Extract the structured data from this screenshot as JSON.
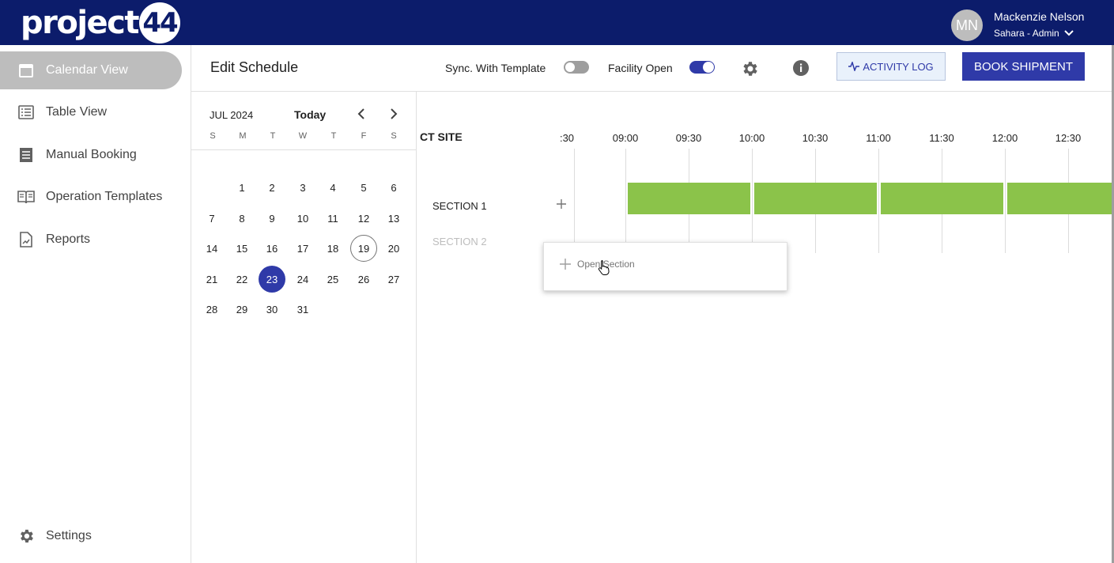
{
  "app": {
    "logo_text": "project",
    "logo_number": "44"
  },
  "user": {
    "initials": "MN",
    "name": "Mackenzie Nelson",
    "org_role": "Sahara - Admin"
  },
  "sidebar": {
    "items": [
      {
        "label": "Calendar View",
        "icon": "calendar-icon",
        "active": true
      },
      {
        "label": "Table View",
        "icon": "list-icon",
        "active": false
      },
      {
        "label": "Manual Booking",
        "icon": "receipt-icon",
        "active": false
      },
      {
        "label": "Operation Templates",
        "icon": "book-icon",
        "active": false
      },
      {
        "label": "Reports",
        "icon": "report-icon",
        "active": false
      }
    ],
    "settings_label": "Settings"
  },
  "header": {
    "title": "Edit Schedule",
    "sync_label": "Sync. With Template",
    "sync_on": false,
    "facility_label": "Facility Open",
    "facility_on": true,
    "activity_log_label": "ACTIVITY LOG",
    "book_label": "BOOK SHIPMENT"
  },
  "calendar": {
    "month": "JUL 2024",
    "today_label": "Today",
    "weekdays": [
      "S",
      "M",
      "T",
      "W",
      "T",
      "F",
      "S"
    ],
    "weeks": [
      [
        "",
        "1",
        "2",
        "3",
        "4",
        "5",
        "6"
      ],
      [
        "7",
        "8",
        "9",
        "10",
        "11",
        "12",
        "13"
      ],
      [
        "14",
        "15",
        "16",
        "17",
        "18",
        "19",
        "20"
      ],
      [
        "21",
        "22",
        "23",
        "24",
        "25",
        "26",
        "27"
      ],
      [
        "28",
        "29",
        "30",
        "31",
        "",
        "",
        ""
      ]
    ],
    "today": "19",
    "selected": "23"
  },
  "schedule": {
    "site": "CT SITE",
    "times": [
      ":30",
      "09:00",
      "09:30",
      "10:00",
      "10:30",
      "11:00",
      "11:30",
      "12:00",
      "12:30"
    ],
    "sections": [
      "SECTION 1",
      "SECTION 2"
    ],
    "popup_item": "Open Section",
    "colors": {
      "open_slot": "#8bc34a",
      "accent": "#2f3aa8",
      "topbar": "#0c1c6b"
    }
  }
}
